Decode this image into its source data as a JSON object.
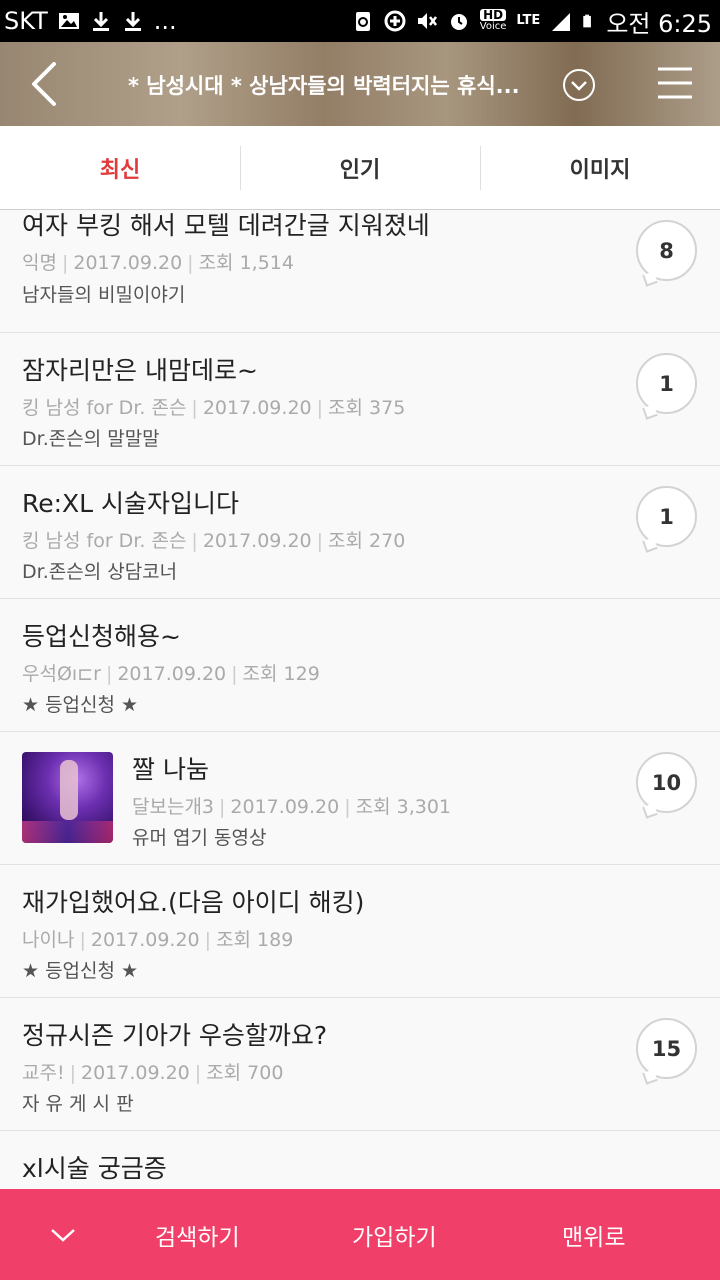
{
  "status_bar": {
    "carrier": "SKT",
    "ellipsis": "...",
    "hd_label": "HD",
    "voice_label": "Voice",
    "lte_label": "LTE",
    "time": "오전 6:25"
  },
  "header": {
    "title": "* 남성시대 * 상남자들의 박력터지는 휴식..."
  },
  "tabs": [
    {
      "label": "최신",
      "active": true
    },
    {
      "label": "인기",
      "active": false
    },
    {
      "label": "이미지",
      "active": false
    }
  ],
  "posts": [
    {
      "title": "여자 부킹 해서 모텔 데려간글 지워졌네",
      "author": "익명",
      "date": "2017.09.20",
      "views": "조회 1,514",
      "category": "남자들의 비밀이야기",
      "comments": "8"
    },
    {
      "title": "잠자리만은 내맘데로~",
      "author": "킹 남성 for Dr. 존슨",
      "date": "2017.09.20",
      "views": "조회 375",
      "category": "Dr.존슨의 말말말",
      "comments": "1"
    },
    {
      "title": "Re:XL 시술자입니다",
      "author": "킹 남성 for Dr. 존슨",
      "date": "2017.09.20",
      "views": "조회 270",
      "category": "Dr.존슨의 상담코너",
      "comments": "1"
    },
    {
      "title": "등업신청해용~",
      "author": "우석Øı⊏r",
      "date": "2017.09.20",
      "views": "조회 129",
      "category": "★ 등업신청 ★",
      "comments": ""
    },
    {
      "title": "짤 나눔",
      "author": "달보는개3",
      "date": "2017.09.20",
      "views": "조회 3,301",
      "category": "유머 엽기 동영상",
      "comments": "10"
    },
    {
      "title": "재가입했어요.(다음 아이디 해킹)",
      "author": "나이나",
      "date": "2017.09.20",
      "views": "조회 189",
      "category": "★ 등업신청 ★",
      "comments": ""
    },
    {
      "title": "정규시즌 기아가 우승할까요?",
      "author": "교주!",
      "date": "2017.09.20",
      "views": "조회 700",
      "category": "자 유 게 시 판",
      "comments": "15"
    },
    {
      "title": "xl시술 궁금증",
      "author": "",
      "date": "",
      "views": "",
      "category": "",
      "comments": ""
    }
  ],
  "bottom_bar": {
    "search_label": "검색하기",
    "join_label": "가입하기",
    "top_label": "맨위로"
  },
  "colors": {
    "accent": "#f0406a",
    "active_tab": "#e03a3a"
  }
}
